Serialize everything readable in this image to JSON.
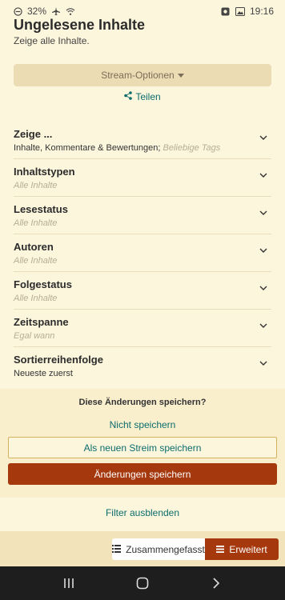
{
  "status_bar": {
    "battery": "32%",
    "time": "19:16"
  },
  "header": {
    "title": "Ungelesene Inhalte",
    "subtitle": "Zeige alle Inhalte."
  },
  "stream_options": {
    "label": "Stream-Optionen"
  },
  "share": {
    "label": "Teilen"
  },
  "filters": [
    {
      "title": "Zeige ...",
      "value": "Inhalte, Kommentare & Bewertungen;",
      "muted": "Beliebige Tags"
    },
    {
      "title": "Inhaltstypen",
      "value": "",
      "muted": "Alle Inhalte"
    },
    {
      "title": "Lesestatus",
      "value": "",
      "muted": "Alle Inhalte"
    },
    {
      "title": "Autoren",
      "value": "",
      "muted": "Alle Inhalte"
    },
    {
      "title": "Folgestatus",
      "value": "",
      "muted": "Alle Inhalte"
    },
    {
      "title": "Zeitspanne",
      "value": "",
      "muted": "Egal wann"
    },
    {
      "title": "Sortierreihenfolge",
      "value": "Neueste zuerst",
      "muted": ""
    }
  ],
  "save_panel": {
    "question": "Diese Änderungen speichern?",
    "dont_save": "Nicht speichern",
    "save_new": "Als neuen Streim speichern",
    "save_changes": "Änderungen speichern"
  },
  "hide_filters": "Filter ausblenden",
  "view_toggle": {
    "summary": "Zusammengefasst",
    "advanced": "Erweitert"
  },
  "colors": {
    "background": "#fcf6dd",
    "accent": "#a5380c",
    "link": "#0c6c6c"
  }
}
